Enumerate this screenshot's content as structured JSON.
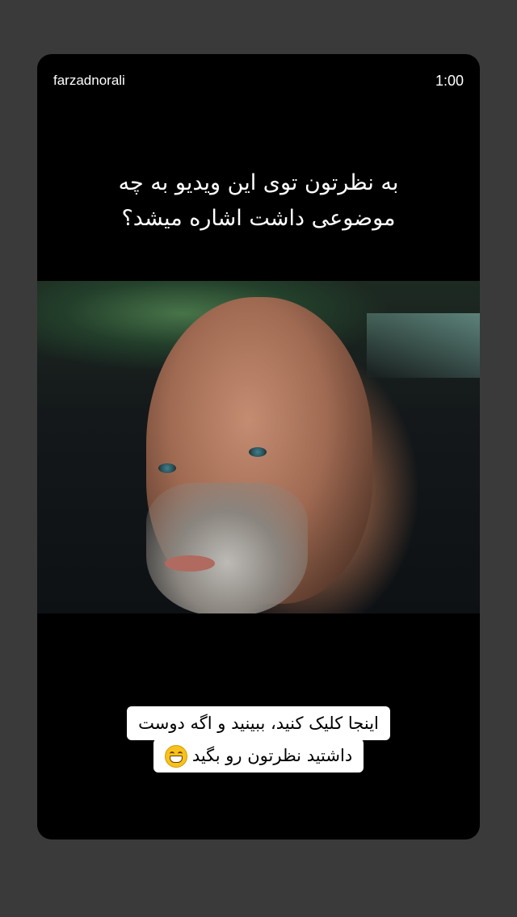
{
  "story": {
    "username": "farzadnorali",
    "timer": "1:00",
    "headline_lines": [
      "به نظرتون توی این ویدیو به چه",
      "موضوعی داشت اشاره میشد؟"
    ],
    "caption_lines": [
      "اینجا کلیک کنید، ببینید و اگه دوست",
      "داشتید نظرتون رو بگید"
    ],
    "caption_emoji": "grinning-face-emoji"
  },
  "colors": {
    "page_background": "#3a3a3a",
    "card_background": "#000000",
    "caption_background": "#ffffff",
    "text_light": "#ffffff"
  }
}
